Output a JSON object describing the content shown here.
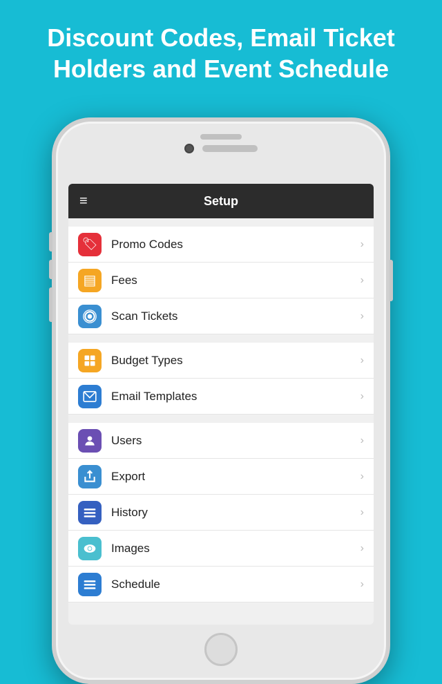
{
  "page": {
    "header": "Discount Codes, Email Ticket Holders and Event Schedule",
    "background_color": "#17bcd4"
  },
  "navbar": {
    "title": "Setup",
    "hamburger_icon": "≡"
  },
  "menu_groups": [
    {
      "id": "group1",
      "items": [
        {
          "id": "promo-codes",
          "label": "Promo Codes",
          "icon": "🏷",
          "icon_class": "icon-red"
        },
        {
          "id": "fees",
          "label": "Fees",
          "icon": "▤",
          "icon_class": "icon-orange"
        },
        {
          "id": "scan-tickets",
          "label": "Scan Tickets",
          "icon": "📷",
          "icon_class": "icon-blue"
        }
      ]
    },
    {
      "id": "group2",
      "items": [
        {
          "id": "budget-types",
          "label": "Budget Types",
          "icon": "▣",
          "icon_class": "icon-amber"
        },
        {
          "id": "email-templates",
          "label": "Email Templates",
          "icon": "✉",
          "icon_class": "icon-blue2"
        }
      ]
    },
    {
      "id": "group3",
      "items": [
        {
          "id": "users",
          "label": "Users",
          "icon": "👤",
          "icon_class": "icon-purple"
        },
        {
          "id": "export",
          "label": "Export",
          "icon": "↗",
          "icon_class": "icon-blue3"
        },
        {
          "id": "history",
          "label": "History",
          "icon": "☰",
          "icon_class": "icon-dkblue"
        },
        {
          "id": "images",
          "label": "Images",
          "icon": "👁",
          "icon_class": "icon-teal"
        },
        {
          "id": "schedule",
          "label": "Schedule",
          "icon": "☰",
          "icon_class": "icon-blue4"
        }
      ]
    }
  ],
  "chevron": "›"
}
